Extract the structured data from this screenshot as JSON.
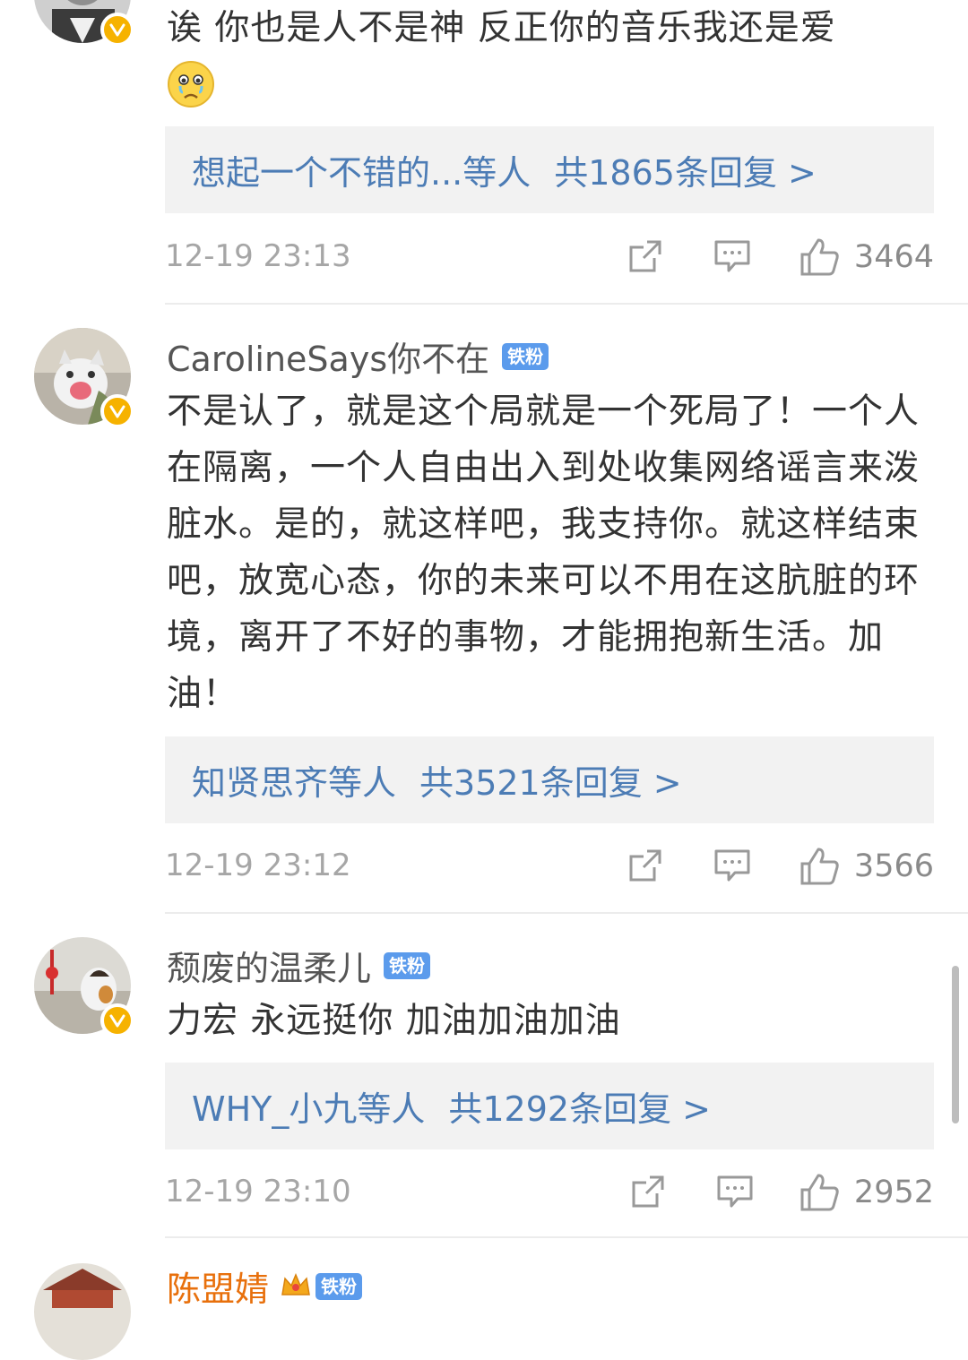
{
  "comments": [
    {
      "username": "",
      "text": "诶 你也是人不是神 反正你的音乐我还是爱",
      "emoji": "😢",
      "reply_users": "想起一个不错的...等人",
      "reply_count": "共1865条回复 >",
      "time": "12-19 23:13",
      "likes": "3464"
    },
    {
      "username": "CarolineSays你不在",
      "badge": "铁粉",
      "text": "不是认了，就是这个局就是一个死局了！一个人在隔离，一个人自由出入到处收集网络谣言来泼脏水。是的，就这样吧，我支持你。就这样结束吧，放宽心态，你的未来可以不用在这肮脏的环境，离开了不好的事物，才能拥抱新生活。加油！",
      "reply_users": "知贤思齐等人",
      "reply_count": "共3521条回复 >",
      "time": "12-19 23:12",
      "likes": "3566"
    },
    {
      "username": "颓废的温柔儿",
      "badge": "铁粉",
      "text": "力宏 永远挺你 加油加油加油",
      "reply_users": "WHY_小九等人",
      "reply_count": "共1292条回复 >",
      "time": "12-19 23:10",
      "likes": "2952"
    },
    {
      "username": "陈盟婧",
      "badge": "铁粉"
    }
  ],
  "colors": {
    "link": "#4c7cb5",
    "verified_badge": "#f6b200",
    "fan_badge": "#5b9bec",
    "vip_name": "#e8700c"
  },
  "icons": [
    "share-icon",
    "comment-icon",
    "like-icon",
    "verified-badge-icon",
    "crown-icon"
  ]
}
